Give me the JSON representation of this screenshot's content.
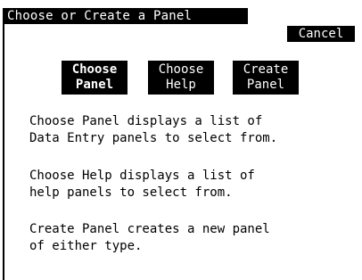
{
  "window": {
    "title": "Choose or Create a Panel",
    "cancel_label": "Cancel"
  },
  "choices": [
    {
      "line1": "Choose",
      "line2": "Panel",
      "selected": true
    },
    {
      "line1": "Choose",
      "line2": "Help",
      "selected": false
    },
    {
      "line1": "Create",
      "line2": "Panel",
      "selected": false
    }
  ],
  "descriptions": [
    {
      "line1": "Choose Panel displays a list of",
      "line2": "Data Entry panels to select from."
    },
    {
      "line1": "Choose Help displays a list of",
      "line2": "help panels to select from."
    },
    {
      "line1": "Create Panel creates a new panel",
      "line2": "of either type."
    }
  ],
  "colors": {
    "background": "#ffffff",
    "foreground": "#000000"
  }
}
